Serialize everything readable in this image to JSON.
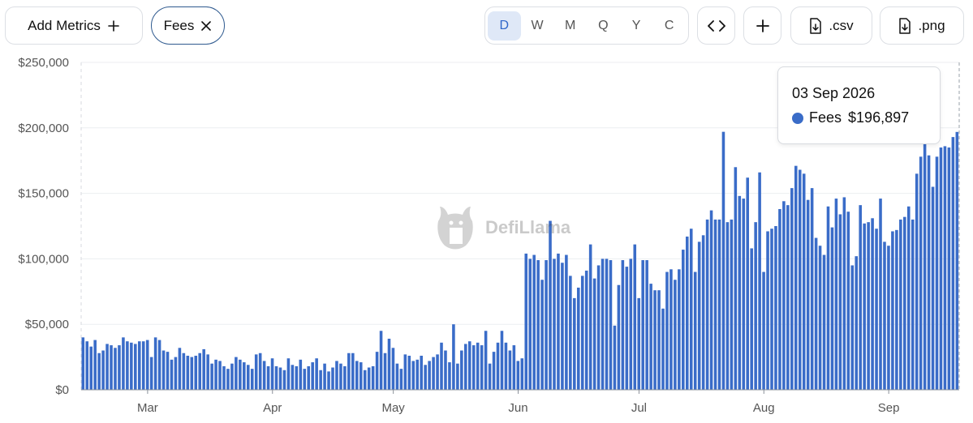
{
  "toolbar": {
    "add_metrics_label": "Add Metrics",
    "fees_chip_label": "Fees",
    "ranges": [
      "D",
      "W",
      "M",
      "Q",
      "Y",
      "C"
    ],
    "active_range": "D",
    "csv_label": ".csv",
    "png_label": ".png"
  },
  "watermark": {
    "text": "DefiLlama"
  },
  "tooltip": {
    "date": "03 Sep 2026",
    "series": "Fees",
    "value": "$196,897"
  },
  "colors": {
    "bar": "#3a6cc8",
    "accent": "#2f66c9"
  },
  "chart_data": {
    "type": "bar",
    "title": "",
    "xlabel": "",
    "ylabel": "",
    "ylim": [
      0,
      250000
    ],
    "y_ticks": [
      0,
      50000,
      100000,
      150000,
      200000,
      250000
    ],
    "y_tick_labels": [
      "$0",
      "$50,000",
      "$100,000",
      "$150,000",
      "$200,000",
      "$250,000"
    ],
    "x_tick_labels": [
      "Mar",
      "Apr",
      "May",
      "Jun",
      "Jul",
      "Aug",
      "Sep"
    ],
    "x_tick_index": [
      16,
      47,
      77,
      108,
      138,
      169,
      200
    ],
    "grid": true,
    "series": [
      {
        "name": "Fees",
        "values": [
          40000,
          37000,
          33000,
          38000,
          28000,
          30000,
          35000,
          34000,
          32000,
          34000,
          40000,
          37000,
          36000,
          35000,
          37000,
          37000,
          38000,
          25000,
          40000,
          38000,
          30000,
          29000,
          23000,
          25000,
          32000,
          28000,
          26000,
          25000,
          26000,
          28000,
          31000,
          27000,
          20000,
          23000,
          22000,
          18000,
          16000,
          20000,
          25000,
          23000,
          21000,
          19000,
          16000,
          27000,
          28000,
          22000,
          18000,
          24000,
          18000,
          17000,
          15000,
          24000,
          19000,
          18000,
          23000,
          16000,
          18000,
          21000,
          24000,
          15000,
          20000,
          14000,
          17000,
          22000,
          20000,
          18000,
          28000,
          28000,
          22000,
          21000,
          15000,
          17000,
          18000,
          29000,
          45000,
          28000,
          39000,
          32000,
          20000,
          16000,
          27000,
          26000,
          22000,
          23000,
          26000,
          19000,
          22000,
          25000,
          27000,
          36000,
          30000,
          21000,
          50000,
          20000,
          30000,
          35000,
          37000,
          34000,
          36000,
          34000,
          45000,
          20000,
          29000,
          36000,
          45000,
          36000,
          30000,
          34000,
          22000,
          24000,
          104000,
          100000,
          103000,
          99000,
          84000,
          99000,
          129000,
          100000,
          104000,
          97000,
          103000,
          87000,
          70000,
          78000,
          87000,
          91000,
          111000,
          85000,
          95000,
          100000,
          100000,
          99000,
          49000,
          80000,
          99000,
          94000,
          100000,
          111000,
          70000,
          99000,
          99000,
          81000,
          76000,
          76000,
          62000,
          90000,
          92000,
          84000,
          92000,
          107000,
          117000,
          123000,
          90000,
          113000,
          118000,
          130000,
          137000,
          130000,
          130000,
          197000,
          128000,
          130000,
          170000,
          148000,
          146000,
          162000,
          108000,
          128000,
          166000,
          90000,
          121000,
          123000,
          125000,
          138000,
          144000,
          141000,
          154000,
          171000,
          168000,
          165000,
          145000,
          154000,
          116000,
          110000,
          103000,
          140000,
          124000,
          146000,
          134000,
          147000,
          136000,
          95000,
          102000,
          141000,
          127000,
          128000,
          131000,
          123000,
          146000,
          113000,
          110000,
          121000,
          122000,
          130000,
          132000,
          140000,
          130000,
          165000,
          178000,
          188000,
          179000,
          155000,
          178000,
          185000,
          186000,
          185000,
          193000,
          196897
        ]
      }
    ]
  }
}
